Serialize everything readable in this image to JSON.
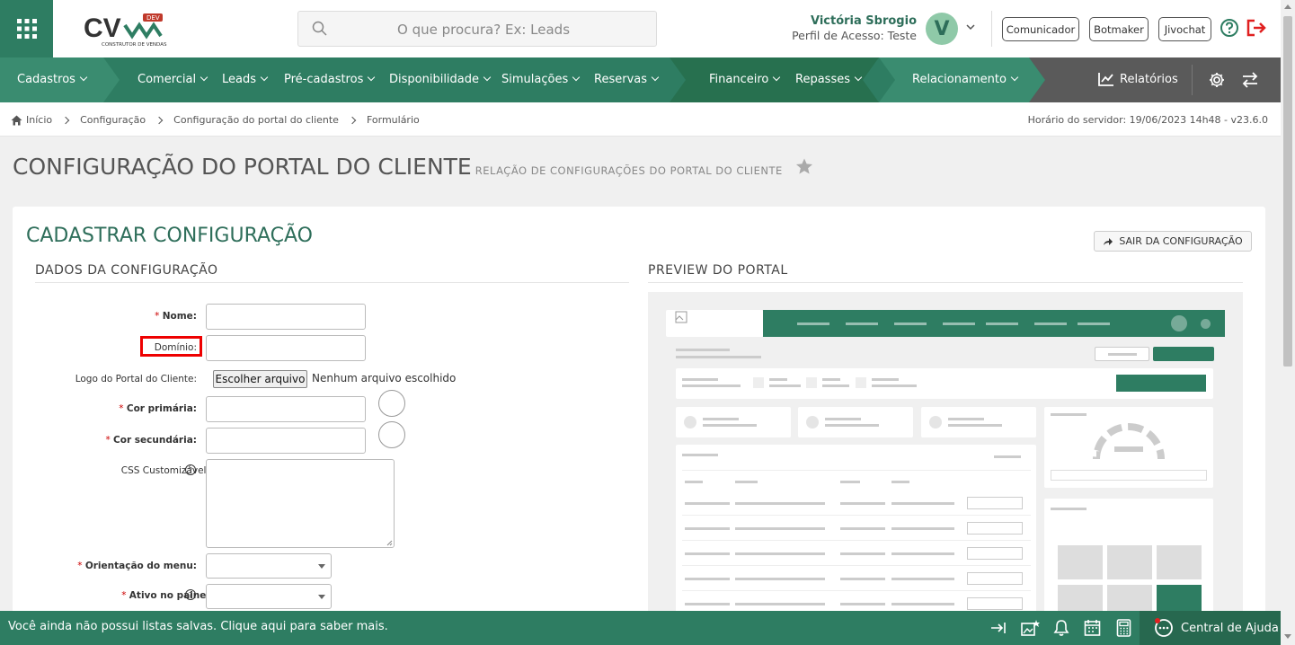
{
  "header": {
    "search_placeholder": "O que procura? Ex: Leads",
    "user_name": "Victória Sbrogio",
    "user_profile": "Perfil de Acesso: Teste",
    "avatar_letter": "V",
    "buttons": [
      "Comunicador",
      "Botmaker",
      "Jivochat"
    ],
    "logo_text": "CV",
    "logo_badge": "DEV",
    "logo_sub": "CONSTRUTOR DE VENDAS"
  },
  "nav": {
    "items": [
      "Cadastros",
      "Comercial",
      "Leads",
      "Pré-cadastros",
      "Disponibilidade",
      "Simulações",
      "Reservas",
      "Financeiro",
      "Repasses",
      "Relacionamento"
    ],
    "reports": "Relatórios"
  },
  "breadcrumb": {
    "items": [
      "Início",
      "Configuração",
      "Configuração do portal do cliente",
      "Formulário"
    ],
    "server_time": "Horário do servidor: 19/06/2023 14h48 - v23.6.0"
  },
  "page": {
    "title": "CONFIGURAÇÃO DO PORTAL DO CLIENTE",
    "subtitle": "RELAÇÃO DE CONFIGURAÇÕES DO PORTAL DO CLIENTE"
  },
  "form": {
    "card_title": "CADASTRAR CONFIGURAÇÃO",
    "exit_label": "SAIR DA CONFIGURAÇÃO",
    "section_left": "DADOS DA CONFIGURAÇÃO",
    "section_right": "PREVIEW DO PORTAL",
    "required_mark": "*",
    "help_mark": "?",
    "labels": {
      "nome": "Nome:",
      "dominio": "Domínio:",
      "logo": "Logo do Portal do Cliente:",
      "cor_primaria": "Cor primária:",
      "cor_secundaria": "Cor secundária:",
      "css": "CSS Customizável:",
      "orientacao": "Orientação do menu:",
      "ativo": "Ativo no painel"
    },
    "file_button": "Escolher arquivo",
    "file_status": "Nenhum arquivo escolhido"
  },
  "bottom": {
    "message": "Você ainda não possui listas salvas. Clique aqui para saber mais.",
    "help_center": "Central de Ajuda"
  },
  "colors": {
    "brand": "#2e7d62",
    "brand_dark": "#27684f",
    "title_green": "#2e6e5a",
    "highlight": "#e00000"
  }
}
